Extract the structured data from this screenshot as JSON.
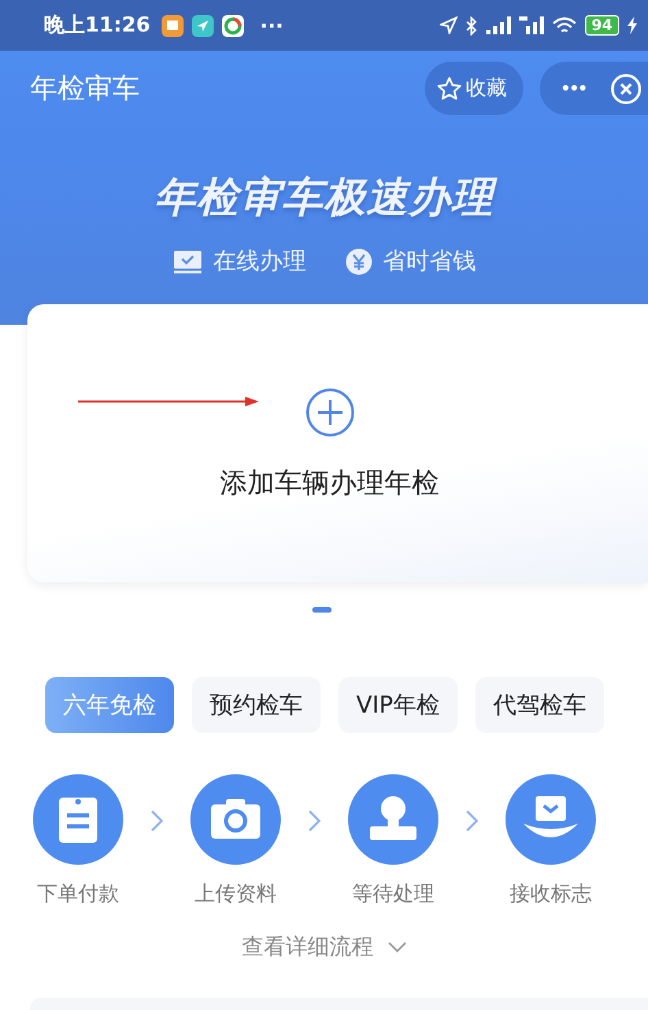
{
  "status_bar": {
    "time": "晚上11:26",
    "more": "···",
    "battery": "94"
  },
  "nav_bar": {
    "title": "年检审车",
    "favorite_button": "收藏",
    "more_button": "•••"
  },
  "hero": {
    "headline": "年检审车极速办理",
    "features": [
      {
        "kind": "online",
        "label": "在线办理"
      },
      {
        "kind": "money",
        "label": "省时省钱"
      }
    ]
  },
  "add_card": {
    "label": "添加车辆办理年检"
  },
  "tabs": [
    {
      "label": "六年免检",
      "selected": true
    },
    {
      "label": "预约检车",
      "selected": false
    },
    {
      "label": "VIP年检",
      "selected": false
    },
    {
      "label": "代驾检车",
      "selected": false
    }
  ],
  "steps": [
    {
      "kind": "order",
      "label": "下单付款"
    },
    {
      "kind": "upload",
      "label": "上传资料"
    },
    {
      "kind": "wait",
      "label": "等待处理"
    },
    {
      "kind": "receive",
      "label": "接收标志"
    }
  ],
  "details_link": "查看详细流程"
}
